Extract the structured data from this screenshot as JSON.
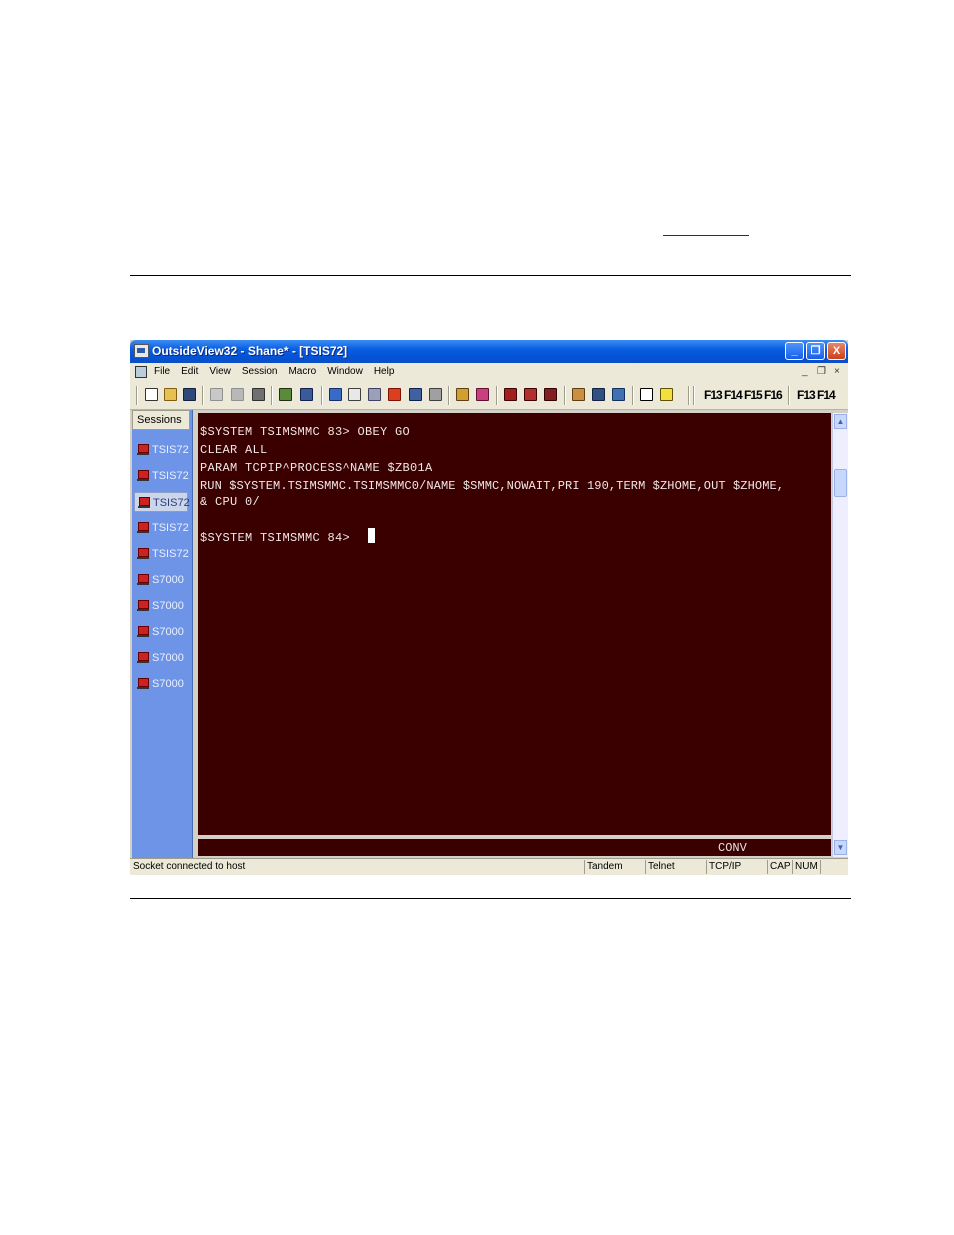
{
  "window": {
    "title": "OutsideView32 - Shane* - [TSIS72]",
    "controls": {
      "minimize": "_",
      "restore": "❐",
      "close": "X"
    }
  },
  "menubar": {
    "items": [
      "File",
      "Edit",
      "View",
      "Session",
      "Macro",
      "Window",
      "Help"
    ],
    "mdi_minimize": "_",
    "mdi_restore": "❐",
    "mdi_close": "×"
  },
  "toolbar": {
    "fkeys_group1": "F13 F14 F15 F16",
    "fkeys_group2": "F13 F14"
  },
  "sessions": {
    "header": "Sessions",
    "items": [
      {
        "label": "TSIS72"
      },
      {
        "label": "TSIS72"
      },
      {
        "label": "TSIS72"
      },
      {
        "label": "TSIS72"
      },
      {
        "label": "TSIS72"
      },
      {
        "label": "S7000"
      },
      {
        "label": "S7000"
      },
      {
        "label": "S7000"
      },
      {
        "label": "S7000"
      },
      {
        "label": "S7000"
      }
    ],
    "active_index": 2
  },
  "terminal": {
    "lines": [
      "$SYSTEM TSIMSMMC 83> OBEY GO",
      "CLEAR ALL",
      "PARAM TCPIP^PROCESS^NAME $ZB01A",
      "RUN $SYSTEM.TSIMSMMC.TSIMSMMC0/NAME $SMMC,NOWAIT,PRI 190,TERM $ZHOME,OUT $ZHOME,",
      "& CPU 0/",
      "",
      "$SYSTEM TSIMSMMC 84> "
    ],
    "mode": "CONV",
    "bg_color": "#3a0000"
  },
  "statusbar": {
    "message": "Socket connected to host",
    "panels": [
      "Tandem",
      "Telnet",
      "TCP/IP",
      "CAP",
      "NUM"
    ]
  }
}
